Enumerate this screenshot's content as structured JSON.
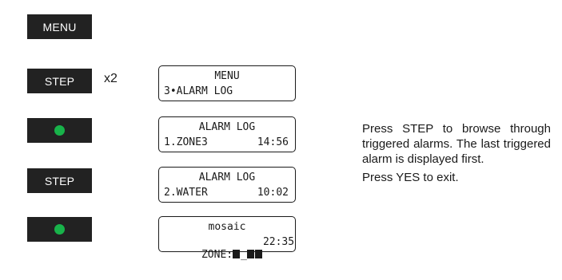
{
  "keys": {
    "menu": "MENU",
    "step": "STEP",
    "step_repeat": "x2",
    "step2": "STEP"
  },
  "screens": [
    {
      "line1": "MENU",
      "line2_left": "3•ALARM LOG",
      "line2_right": ""
    },
    {
      "line1": "ALARM LOG",
      "line2_left": "1.ZONE3",
      "line2_right": "14:56"
    },
    {
      "line1": "ALARM LOG",
      "line2_left": "2.WATER",
      "line2_right": "10:02"
    },
    {
      "line1": "mosaic",
      "line2_left": "ZONE:",
      "line2_zone_tail": "_",
      "line2_right": "22:35"
    }
  ],
  "instructions": {
    "paragraph": "Press STEP to browse through triggered alarms. The last triggered alarm is displayed first.",
    "exit": "Press YES to exit."
  },
  "colors": {
    "key_background": "#222222",
    "key_text": "#ffffff",
    "yes_dot": "#18b34a",
    "lcd_border": "#1a1a1a"
  }
}
